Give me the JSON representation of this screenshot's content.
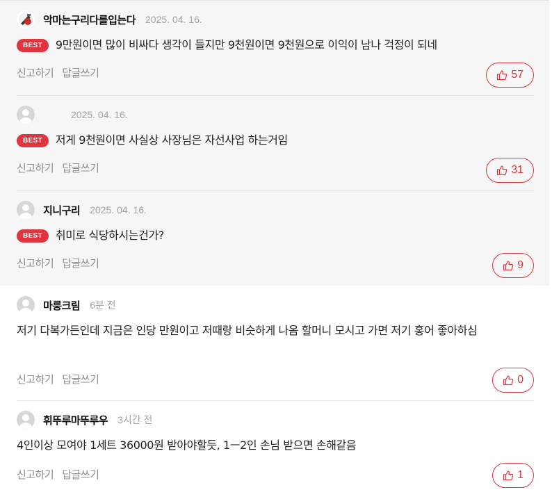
{
  "ui": {
    "report_label": "신고하기",
    "reply_label": "답글쓰기",
    "best_badge": "BEST",
    "accent_color": "#e0353f"
  },
  "comments": [
    {
      "nickname": "악마는구리다를입는다",
      "date": "2025. 04. 16.",
      "best": true,
      "text": "9만원이면 많이 비싸다 생각이 들지만 9천원이면 9천원으로 이익이 남나 걱정이 되네",
      "likes": "57"
    },
    {
      "nickname": "",
      "date": "2025. 04. 16.",
      "best": true,
      "text": "저게 9천원이면 사실상 사장님은 자선사업 하는거임",
      "likes": "31"
    },
    {
      "nickname": "지니구리",
      "date": "2025. 04. 16.",
      "best": true,
      "text": "취미로 식당하시는건가?",
      "likes": "9"
    },
    {
      "nickname": "마룽크림",
      "date": "6분 전",
      "best": false,
      "text": " 저기 다복가든인데 지금은 인당 만원이고 저때랑 비슷하게 나옴 할머니 모시고 가면 저기 홍어 좋아하심",
      "likes": "0"
    },
    {
      "nickname": "휘뚜루마뚜루우",
      "date": "3시간 전",
      "best": false,
      "text": " 4인이상 모여야 1세트 36000원 받아야할듯, 1ㅡ2인 손님 받으면 손해같음",
      "likes": "1"
    }
  ]
}
